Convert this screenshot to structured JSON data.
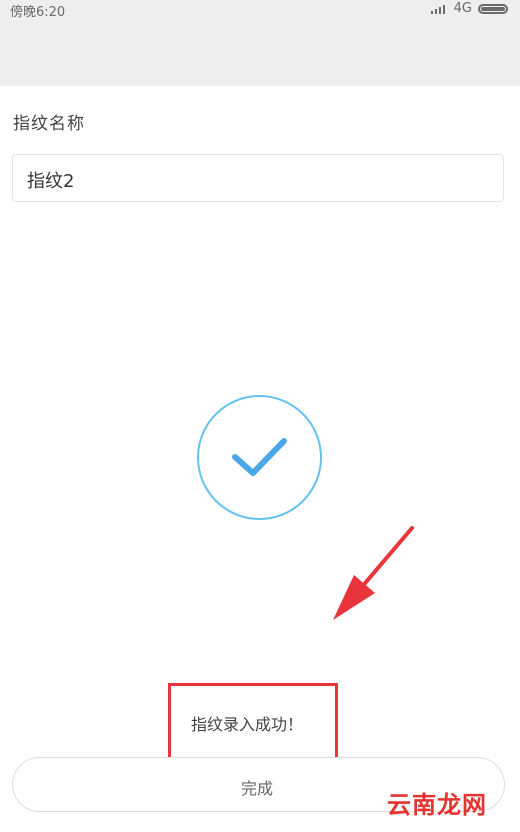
{
  "status_bar": {
    "time": "傍晚6:20",
    "network": "4G"
  },
  "form": {
    "label": "指纹名称",
    "name_value": "指纹2"
  },
  "result": {
    "message": "指纹录入成功！",
    "done_label": "完成"
  },
  "watermark": "云南龙网",
  "colors": {
    "highlight": "#e8343b",
    "check": "#64c2f0"
  }
}
